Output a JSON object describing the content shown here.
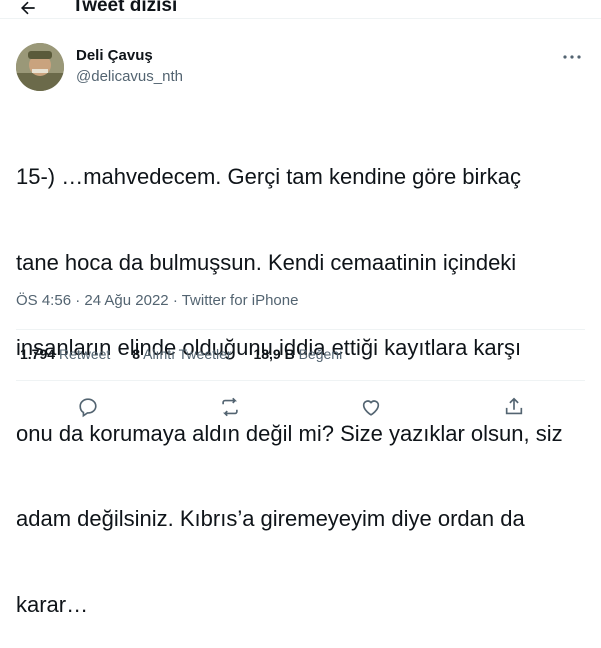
{
  "header": {
    "title": "Tweet dizisi"
  },
  "author": {
    "name": "Deli Çavuş",
    "handle": "@delicavus_nth"
  },
  "tweet": {
    "lines": [
      "15-) …mahvedecem. Gerçi tam kendine göre birkaç",
      "tane hoca da bulmuşsun. Kendi cemaatinin içindeki",
      "insanların elinde olduğunu iddia ettiği kayıtlara karşı",
      "onu da korumaya aldın değil mi? Size yazıklar olsun, siz",
      "adam değilsiniz. Kıbrıs’a giremeyeyim diye ordan da",
      "karar…"
    ]
  },
  "meta": {
    "time": "ÖS 4:56",
    "sep1": " · ",
    "date": "24 Ağu 2022",
    "sep2": " · ",
    "source": "Twitter for iPhone"
  },
  "stats": {
    "retweets_num": "1.794",
    "retweets_label": "Retweet",
    "quotes_num": "8",
    "quotes_label": "Alıntı Tweetler",
    "likes_num": "18,9 B",
    "likes_label": "Beğeni"
  },
  "colors": {
    "text": "#0f1419",
    "secondary": "#536471",
    "divider": "#eff3f4"
  },
  "icons": [
    "back-arrow-icon",
    "more-icon",
    "reply-icon",
    "retweet-icon",
    "like-icon",
    "share-icon"
  ]
}
